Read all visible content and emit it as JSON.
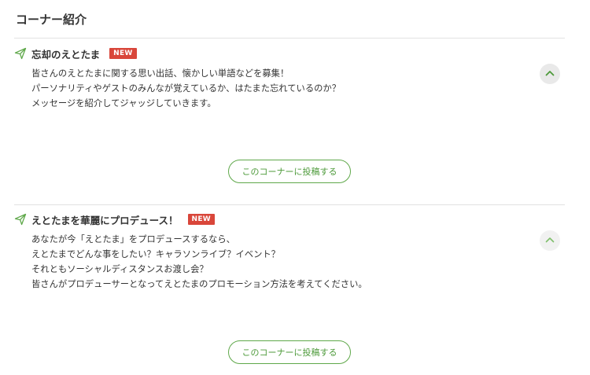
{
  "section": {
    "title": "コーナー紹介"
  },
  "corners": [
    {
      "title": "忘却のえとたま",
      "badge": "NEW",
      "lines": [
        "皆さんのえとたまに関する思い出話、懐かしい単語などを募集！",
        "パーソナリティやゲストのみんなが覚えているか、はたまた忘れているのか？",
        "メッセージを紹介してジャッジしていきます。"
      ],
      "button_label": "このコーナーに投稿する",
      "icons": {
        "title": "send-icon",
        "toggle": "chevron-up-icon"
      }
    },
    {
      "title": "えとたまを華麗にプロデュース！",
      "badge": "NEW",
      "lines": [
        "あなたが今「えとたま」をプロデュースするなら、",
        "えとたまでどんな事をしたい？キャラソンライブ？イベント？",
        "それともソーシャルディスタンスお渡し会？",
        "皆さんがプロデューサーとなってえとたまのプロモーション方法を考えてください。"
      ],
      "button_label": "このコーナーに投稿する",
      "icons": {
        "title": "send-icon",
        "toggle": "chevron-up-icon"
      }
    }
  ],
  "colors": {
    "accent_green": "#5fa84a",
    "badge_red": "#d9463a",
    "divider": "#e2e2e2"
  }
}
